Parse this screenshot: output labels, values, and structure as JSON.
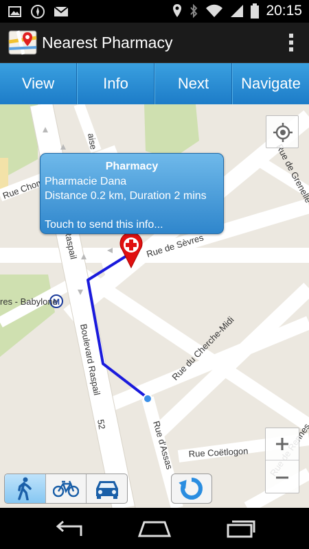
{
  "status_bar": {
    "time": "20:15",
    "left_icons": [
      "image-icon",
      "compass-icon",
      "gmail-icon"
    ],
    "right_icons": [
      "location-icon",
      "bluetooth-icon",
      "wifi-icon",
      "signal-icon",
      "battery-icon"
    ]
  },
  "action_bar": {
    "title": "Nearest Pharmacy",
    "app_icon": "maps-pin-icon",
    "overflow_icon": "overflow-menu-icon"
  },
  "tabs": [
    {
      "label": "View"
    },
    {
      "label": "Info"
    },
    {
      "label": "Next"
    },
    {
      "label": "Navigate"
    }
  ],
  "popup": {
    "title": "Pharmacy",
    "name": "Pharmacie Dana",
    "distance": "Distance 0.2 km, Duration 2 mins",
    "action": "Touch to send this info..."
  },
  "map": {
    "streets": {
      "rue_de_sevres": "Rue de Sèvres",
      "boulevard_raspail": "Boulevard Raspail",
      "raspail_top": "Raspail",
      "rue_du_cherche_midi": "Rue du Cherche-Midi",
      "rue_dassas": "Rue d'Assas",
      "rue_coetlogon": "Rue Coëtlogon",
      "rue_de_grenelle": "Rue de Grenelle",
      "rue_de_rennes": "Rue de Rennes",
      "rue_chom": "Rue Chom",
      "aise": "aise",
      "babylone": "res - Babylone",
      "road_number": "52"
    },
    "metro_label": "M",
    "route_color": "#1a1adc",
    "marker_color": "#e01010"
  },
  "controls": {
    "locate": "my-location-icon",
    "zoom_in": "+",
    "zoom_out": "−",
    "modes": [
      {
        "name": "walk-mode-icon",
        "active": true
      },
      {
        "name": "bike-mode-icon",
        "active": false
      },
      {
        "name": "car-mode-icon",
        "active": false
      }
    ],
    "refresh": "refresh-icon"
  },
  "nav_bar": {
    "back": "back-icon",
    "home": "home-icon",
    "recents": "recents-icon"
  }
}
